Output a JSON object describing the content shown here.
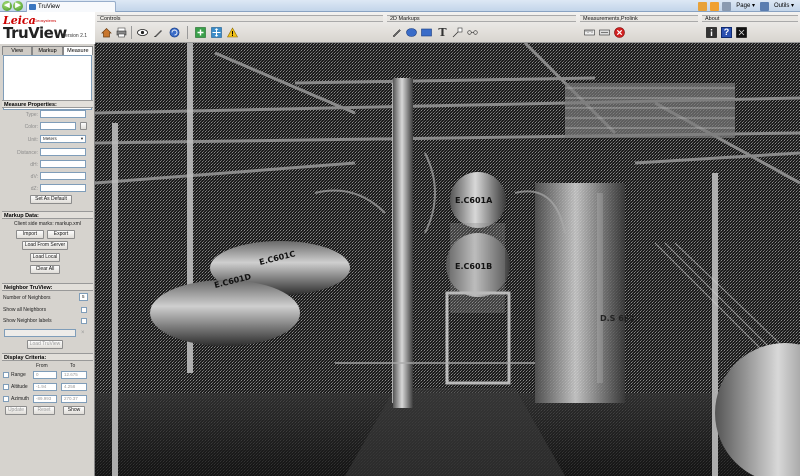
{
  "browser": {
    "tab_title": "TruView",
    "back_glyph": "◀",
    "forward_glyph": "▶",
    "page_menu": "Page ▾",
    "tools_menu": "Outils ▾"
  },
  "logo": {
    "brand": "Leica",
    "sub": "Geosystems",
    "product": "TruView",
    "version": "Version 2.1"
  },
  "tabs": [
    "View",
    "Markup",
    "Measure"
  ],
  "measure_properties": {
    "title": "Measure Properties:",
    "type_label": "Type:",
    "type_value": "",
    "color_label": "Color:",
    "unit_label": "Unit:",
    "unit_value": "Meters",
    "distance_label": "Distance:",
    "dh_label": "dH:",
    "dv_label": "dV:",
    "dz_label": "dZ:",
    "set_default": "Set As Default"
  },
  "markup_data": {
    "title": "Markup Data:",
    "client_file": "Client side marks: markup.xml",
    "import": "Import",
    "export": "Export",
    "load_from_server": "Load From Server",
    "load_local": "Load Local",
    "clear_all": "Clear All"
  },
  "neighbor": {
    "title": "Neighbor TruView:",
    "number_label": "Number of Neighbors",
    "number_value": "5",
    "show_all": "Show all Neighbors",
    "show_labels": "Show Neighbor labels",
    "load": "Load TruView"
  },
  "display_criteria": {
    "title": "Display Criteria:",
    "from_label": "From",
    "to_label": "To",
    "rows": [
      {
        "label": "Range",
        "from": "0",
        "to": "12.675"
      },
      {
        "label": "Altitude",
        "from": "-1.94",
        "to": "4.258"
      },
      {
        "label": "Azimuth",
        "from": "-89.993",
        "to": "270.37"
      }
    ],
    "update": "Update",
    "reset": "Reset",
    "show": "Show"
  },
  "toolbar": {
    "controls_title": "Controls",
    "markups_title": "2D Markups",
    "measure_title": "Measurements,Prolink",
    "about_title": "About",
    "text_tool_glyph": "T",
    "help_glyph": "?"
  },
  "scene_labels": [
    "E.C601A",
    "E.C601B",
    "E.C601C",
    "E.C601D",
    "D.S 651"
  ],
  "colors": {
    "panel_bg": "#d6d3ce",
    "toolbar_bg": "#e4e2de",
    "brand_red": "#cc0000",
    "viewer_bg": "#1a1a1a"
  }
}
